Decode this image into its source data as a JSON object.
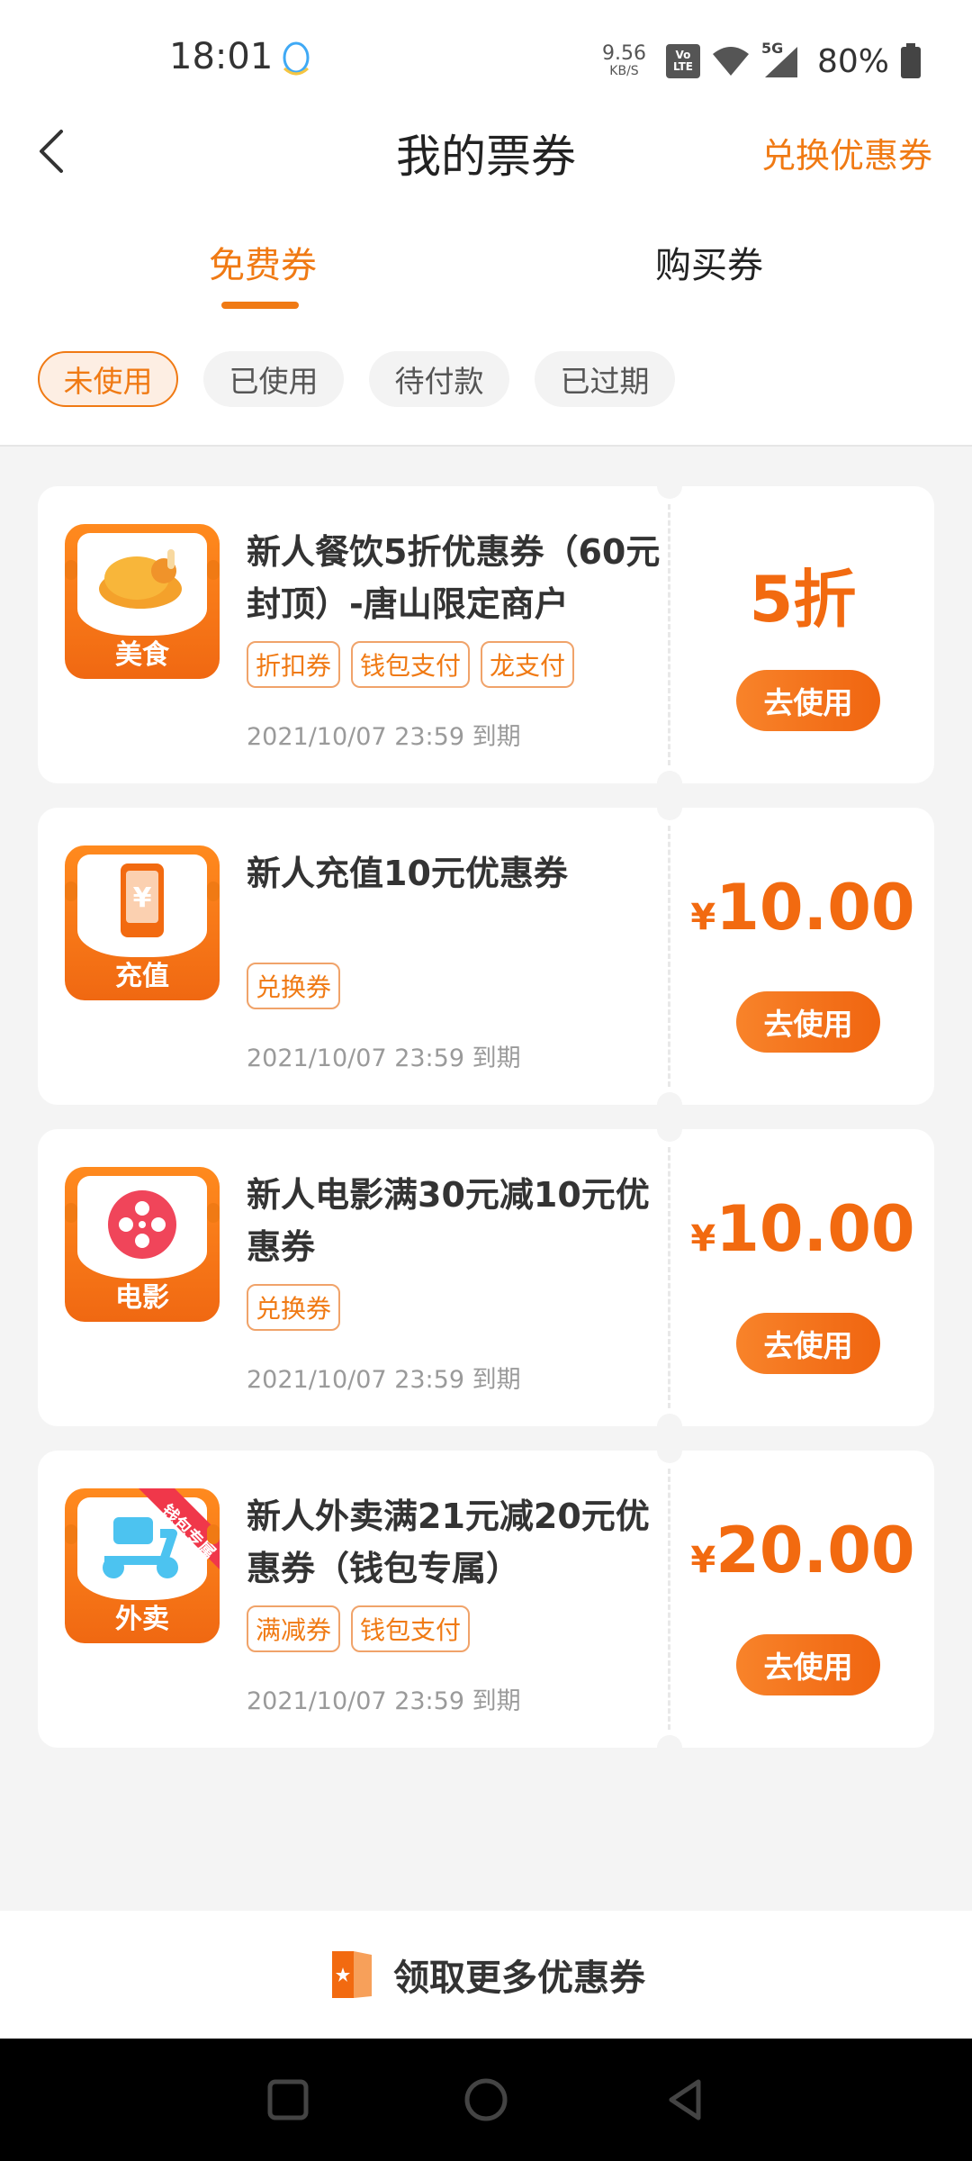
{
  "status_bar": {
    "time": "18:01",
    "net_speed_value": "9.56",
    "net_speed_unit": "KB/S",
    "volte_top": "Vo",
    "volte_bottom": "LTE",
    "network": "5G",
    "battery": "80%"
  },
  "header": {
    "title": "我的票券",
    "redeem_label": "兑换优惠券"
  },
  "tabs": [
    {
      "label": "免费券",
      "active": true
    },
    {
      "label": "购买券",
      "active": false
    }
  ],
  "filters": [
    {
      "label": "未使用",
      "active": true
    },
    {
      "label": "已使用",
      "active": false
    },
    {
      "label": "待付款",
      "active": false
    },
    {
      "label": "已过期",
      "active": false
    }
  ],
  "coupons": [
    {
      "category": "美食",
      "category_icon": "roast-chicken-icon",
      "title": "新人餐饮5折优惠券（60元封顶）-唐山限定商户",
      "tags": [
        "折扣券",
        "钱包支付",
        "龙支付"
      ],
      "expiry": "2021/10/07 23:59 到期",
      "amount_prefix": "",
      "amount": "5折",
      "button": "去使用"
    },
    {
      "category": "充值",
      "category_icon": "phone-yuan-icon",
      "title": "新人充值10元优惠券",
      "tags": [
        "兑换券"
      ],
      "expiry": "2021/10/07 23:59 到期",
      "amount_prefix": "¥",
      "amount": "10.00",
      "button": "去使用"
    },
    {
      "category": "电影",
      "category_icon": "film-reel-icon",
      "title": "新人电影满30元减10元优惠券",
      "tags": [
        "兑换券"
      ],
      "expiry": "2021/10/07 23:59 到期",
      "amount_prefix": "¥",
      "amount": "10.00",
      "button": "去使用"
    },
    {
      "category": "外卖",
      "category_icon": "scooter-icon",
      "ribbon": "钱包专属",
      "title": "新人外卖满21元减20元优惠券（钱包专属）",
      "tags": [
        "满减券",
        "钱包支付"
      ],
      "expiry": "2021/10/07 23:59 到期",
      "amount_prefix": "¥",
      "amount": "20.00",
      "button": "去使用"
    }
  ],
  "footer": {
    "get_more_label": "领取更多优惠券"
  },
  "colors": {
    "accent": "#f07a14",
    "amount": "#f26a10",
    "background": "#f4f4f4"
  }
}
